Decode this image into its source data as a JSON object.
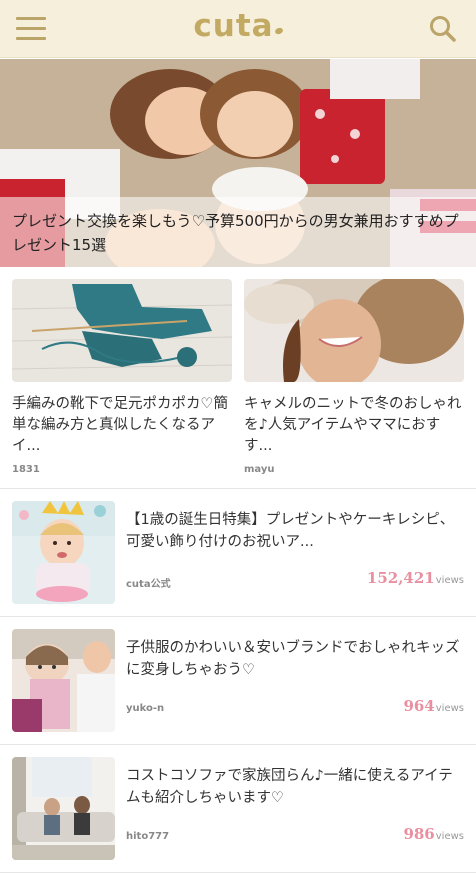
{
  "header": {
    "logo": "cuta",
    "menu_icon": "hamburger-menu-icon",
    "search_icon": "search-icon",
    "background": "#f6efdc",
    "accent": "#c2aa63"
  },
  "hero": {
    "caption": "プレゼント交換を楽しもう♡予算500円からの男女兼用おすすめプレゼント15選"
  },
  "grid": [
    {
      "title": "手編みの靴下で足元ポカポカ♡簡単な編み方と真似したくなるアイ...",
      "author": "1831"
    },
    {
      "title": "キャメルのニットで冬のおしゃれを♪人気アイテムやママにおすす...",
      "author": "mayu"
    }
  ],
  "list": [
    {
      "title": "【1歳の誕生日特集】プレゼントやケーキレシピ、可愛い飾り付けのお祝いア...",
      "author": "cuta公式",
      "views": "152,421",
      "views_unit": "views"
    },
    {
      "title": "子供服のかわいい＆安いブランドでおしゃれキッズに変身しちゃおう♡",
      "author": "yuko-n",
      "views": "964",
      "views_unit": "views"
    },
    {
      "title": "コストコソファで家族団らん♪一緒に使えるアイテムも紹介しちゃいます♡",
      "author": "hito777",
      "views": "986",
      "views_unit": "views"
    }
  ],
  "colors": {
    "views": "#e88fa0",
    "divider": "#e6e6e6"
  }
}
